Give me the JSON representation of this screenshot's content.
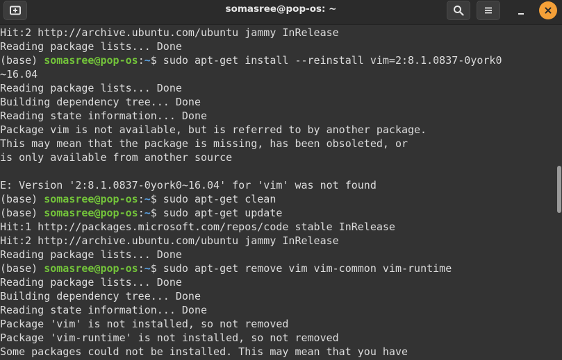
{
  "window": {
    "title": "somasree@pop-os: ~"
  },
  "titlebar": {
    "new_tab_icon": "new-tab-icon",
    "search_icon": "search-icon",
    "menu_icon": "hamburger-menu-icon",
    "minimize_icon": "minimize-icon",
    "close_icon": "close-icon",
    "close_color": "#f4a038"
  },
  "colors": {
    "background": "#333333",
    "text": "#dcdcdc",
    "user_host": "#73c43a",
    "path": "#5aa0e0"
  },
  "terminal": {
    "lines": [
      {
        "text": "Hit:2 http://archive.ubuntu.com/ubuntu jammy InRelease"
      },
      {
        "text": "Reading package lists... Done"
      },
      {
        "prefix": "(base) ",
        "user": "somasree@pop-os",
        "sep": ":",
        "path": "~",
        "cmd": "$ sudo apt-get install --reinstall vim=2:8.1.0837-0york0"
      },
      {
        "text": "~16.04"
      },
      {
        "text": "Reading package lists... Done"
      },
      {
        "text": "Building dependency tree... Done"
      },
      {
        "text": "Reading state information... Done"
      },
      {
        "text": "Package vim is not available, but is referred to by another package."
      },
      {
        "text": "This may mean that the package is missing, has been obsoleted, or"
      },
      {
        "text": "is only available from another source"
      },
      {
        "text": ""
      },
      {
        "text": "E: Version '2:8.1.0837-0york0~16.04' for 'vim' was not found"
      },
      {
        "prefix": "(base) ",
        "user": "somasree@pop-os",
        "sep": ":",
        "path": "~",
        "cmd": "$ sudo apt-get clean"
      },
      {
        "prefix": "(base) ",
        "user": "somasree@pop-os",
        "sep": ":",
        "path": "~",
        "cmd": "$ sudo apt-get update"
      },
      {
        "text": "Hit:1 http://packages.microsoft.com/repos/code stable InRelease"
      },
      {
        "text": "Hit:2 http://archive.ubuntu.com/ubuntu jammy InRelease"
      },
      {
        "text": "Reading package lists... Done"
      },
      {
        "prefix": "(base) ",
        "user": "somasree@pop-os",
        "sep": ":",
        "path": "~",
        "cmd": "$ sudo apt-get remove vim vim-common vim-runtime"
      },
      {
        "text": "Reading package lists... Done"
      },
      {
        "text": "Building dependency tree... Done"
      },
      {
        "text": "Reading state information... Done"
      },
      {
        "text": "Package 'vim' is not installed, so not removed"
      },
      {
        "text": "Package 'vim-runtime' is not installed, so not removed"
      },
      {
        "text": "Some packages could not be installed. This may mean that you have"
      }
    ]
  }
}
